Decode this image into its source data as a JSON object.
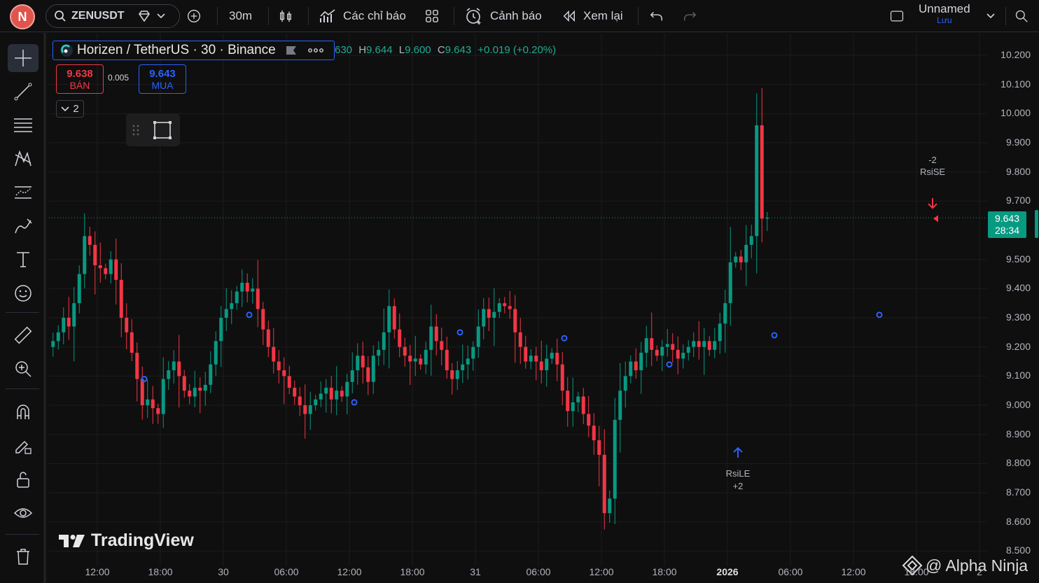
{
  "topbar": {
    "avatar_letter": "N",
    "symbol": "ZENUSDT",
    "interval": "30m",
    "indicators_label": "Các chỉ báo",
    "alerts_label": "Cảnh báo",
    "replay_label": "Xem lại",
    "layout_name": "Unnamed",
    "save_label": "Lưu"
  },
  "legend": {
    "title": "Horizen / TetherUS · 30 · Binance",
    "open_partial": "630",
    "high_key": "H",
    "high": "9.644",
    "low_key": "L",
    "low": "9.600",
    "close_key": "C",
    "close": "9.643",
    "change": "+0.019 (+0.20%)",
    "sell_price": "9.638",
    "sell_label": "BÁN",
    "spread": "0.005",
    "buy_price": "9.643",
    "buy_label": "MUA",
    "collapsed_count": "2"
  },
  "price_tag": {
    "price": "9.643",
    "countdown": "28:34"
  },
  "chart_data": {
    "type": "candlestick",
    "symbol": "ZENUSDT",
    "exchange": "Binance",
    "interval": "30",
    "ylim": [
      8.5,
      10.25
    ],
    "y_ticks": [
      "10.200",
      "10.100",
      "10.000",
      "9.900",
      "9.800",
      "9.700",
      "9.643",
      "9.500",
      "9.400",
      "9.300",
      "9.200",
      "9.100",
      "9.000",
      "8.900",
      "8.800",
      "8.700",
      "8.600",
      "8.500"
    ],
    "x_ticks": [
      "12:00",
      "18:00",
      "30",
      "06:00",
      "12:00",
      "18:00",
      "31",
      "06:00",
      "12:00",
      "18:00",
      "2026",
      "06:00",
      "12:00",
      "18:00",
      "2"
    ],
    "last_price": 9.643,
    "colors": {
      "up": "#089981",
      "down": "#f23645",
      "marker": "#2962ff"
    },
    "close_series": [
      9.22,
      9.25,
      9.3,
      9.27,
      9.35,
      9.45,
      9.58,
      9.55,
      9.48,
      9.47,
      9.45,
      9.5,
      9.43,
      9.3,
      9.25,
      9.18,
      9.09,
      9.0,
      9.02,
      8.99,
      8.97,
      9.09,
      9.12,
      9.15,
      9.1,
      9.05,
      9.03,
      9.06,
      9.05,
      9.07,
      9.14,
      9.22,
      9.3,
      9.33,
      9.35,
      9.39,
      9.42,
      9.39,
      9.4,
      9.33,
      9.26,
      9.2,
      9.15,
      9.12,
      9.1,
      9.06,
      9.03,
      9.0,
      8.97,
      9.0,
      9.02,
      9.04,
      9.06,
      9.02,
      9.05,
      9.03,
      9.08,
      9.12,
      9.17,
      9.13,
      9.08,
      9.17,
      9.19,
      9.25,
      9.34,
      9.26,
      9.2,
      9.17,
      9.15,
      9.16,
      9.14,
      9.19,
      9.27,
      9.22,
      9.19,
      9.12,
      9.09,
      9.12,
      9.14,
      9.16,
      9.2,
      9.27,
      9.33,
      9.3,
      9.32,
      9.35,
      9.34,
      9.33,
      9.25,
      9.2,
      9.15,
      9.17,
      9.15,
      9.12,
      9.16,
      9.18,
      9.14,
      9.05,
      8.98,
      9.01,
      9.03,
      8.97,
      8.93,
      8.88,
      8.83,
      8.63,
      8.68,
      8.95,
      9.05,
      9.1,
      9.15,
      9.12,
      9.18,
      9.23,
      9.19,
      9.17,
      9.2,
      9.21,
      9.19,
      9.16,
      9.18,
      9.2,
      9.22,
      9.2,
      9.22,
      9.19,
      9.22,
      9.28,
      9.35,
      9.49,
      9.51,
      9.49,
      9.55,
      9.58,
      9.96,
      9.64,
      9.643
    ],
    "signals": [
      {
        "label": "RsiLE",
        "qty": "+2",
        "side": "buy"
      },
      {
        "label": "RsiSE",
        "qty": "-2",
        "side": "sell"
      }
    ]
  },
  "branding": {
    "logo_text": "TradingView",
    "watermark": "@ Alpha Ninja"
  }
}
